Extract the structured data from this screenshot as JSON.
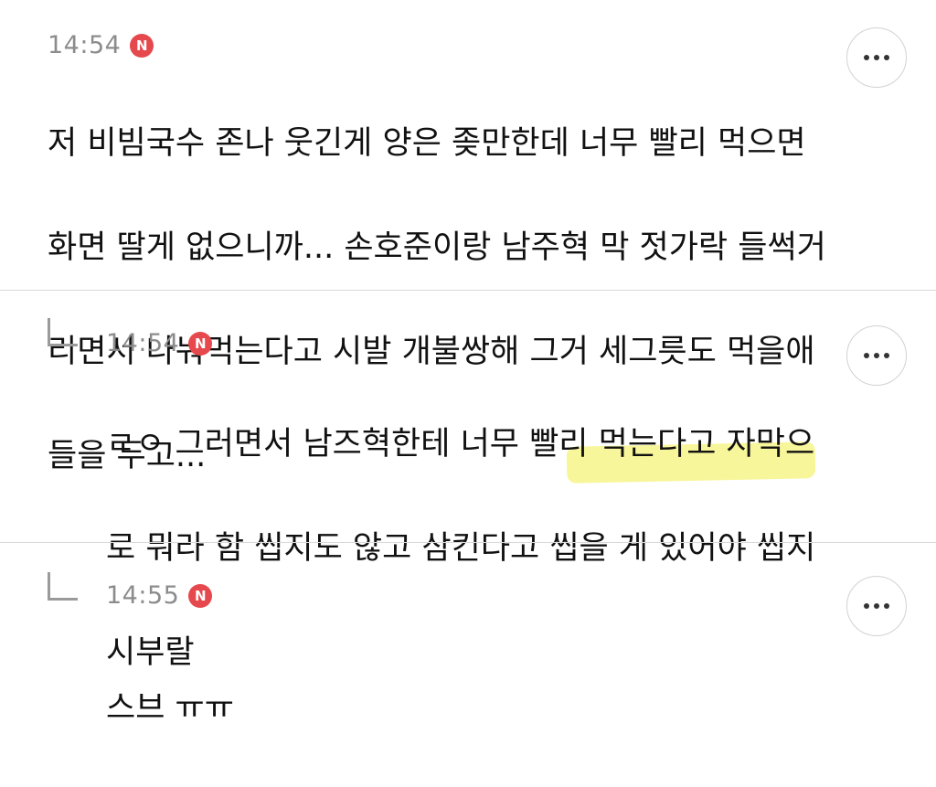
{
  "comments": [
    {
      "time": "14:54",
      "badge": "N",
      "lines": [
        "저 비빔국수 존나 웃긴게 양은 좆만한데 너무 빨리 먹으면",
        "화면 딸게 없으니까... 손호준이랑 남주혁 막 젓가락 들썩거",
        "리면서 나눠먹는다고 시발 개불쌍해 그거 세그릇도 먹을애",
        "들을 두고..."
      ]
    },
    {
      "time": "14:54",
      "badge": "N",
      "lines": [
        "ㄹㅇ 그러면서 남즈혁한테 너무 빨리 먹는다고 자막으",
        "로 뭐라 함 씹지도 않고 삼킨다고 씹을 게 있어야 씹지",
        "시부랄"
      ]
    },
    {
      "time": "14:55",
      "badge": "N",
      "lines": [
        "스브 ㅠㅠ"
      ]
    }
  ],
  "icons": {
    "more": "more-options-icon",
    "badge": "new-badge-icon",
    "reply": "reply-arrow-icon"
  },
  "colors": {
    "badge": "#e5484d",
    "timestamp": "#8c8c8c",
    "highlight": "#f6f37a",
    "divider": "#d9d9d9"
  }
}
